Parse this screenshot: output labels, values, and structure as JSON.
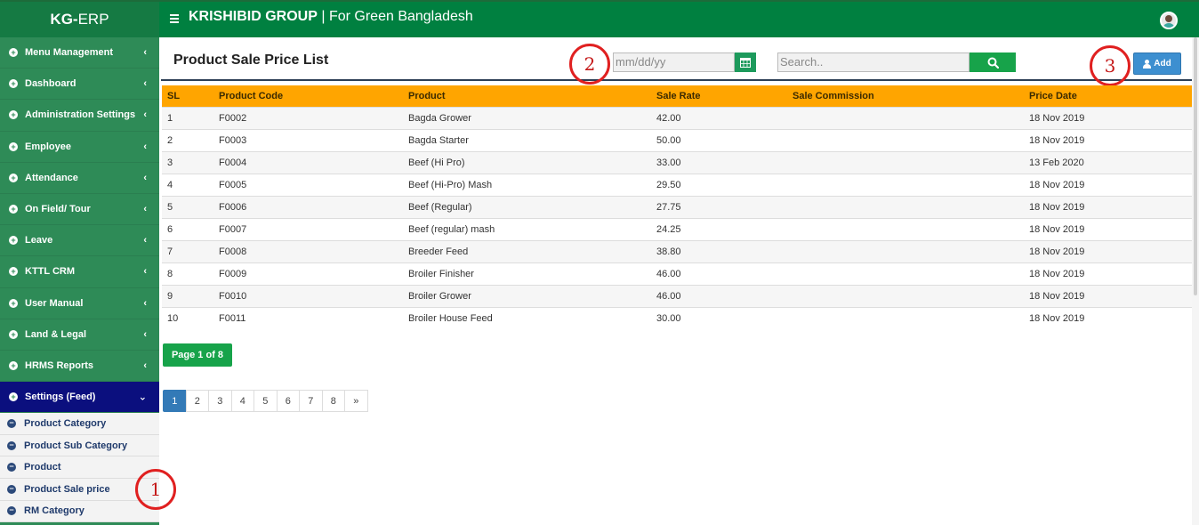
{
  "app": {
    "brand_bold": "KG-",
    "brand_rest": "ERP",
    "company_bold": "KRISHIBID GROUP",
    "company_rest": " | For Green Bangladesh"
  },
  "sidebar": {
    "items": [
      {
        "label": "Menu Management"
      },
      {
        "label": "Dashboard"
      },
      {
        "label": "Administration Settings"
      },
      {
        "label": "Employee"
      },
      {
        "label": "Attendance"
      },
      {
        "label": "On Field/ Tour"
      },
      {
        "label": "Leave"
      },
      {
        "label": "KTTL CRM"
      },
      {
        "label": "User Manual"
      },
      {
        "label": "Land & Legal"
      },
      {
        "label": "HRMS Reports"
      },
      {
        "label": "Settings (Feed)"
      }
    ],
    "sub_items": [
      {
        "label": "Product Category"
      },
      {
        "label": "Product Sub Category"
      },
      {
        "label": "Product"
      },
      {
        "label": "Product Sale price"
      },
      {
        "label": "RM Category"
      }
    ]
  },
  "main": {
    "title": "Product Sale Price List",
    "date_placeholder": "mm/dd/yy",
    "search_placeholder": "Search..",
    "add_label": "Add",
    "page_info": "Page 1 of 8"
  },
  "callouts": [
    "1",
    "2",
    "3"
  ],
  "table": {
    "headers": [
      "SL",
      "Product Code",
      "Product",
      "Sale Rate",
      "Sale Commission",
      "Price Date"
    ],
    "rows": [
      [
        "1",
        "F0002",
        "Bagda Grower",
        "42.00",
        "",
        "18 Nov 2019"
      ],
      [
        "2",
        "F0003",
        "Bagda Starter",
        "50.00",
        "",
        "18 Nov 2019"
      ],
      [
        "3",
        "F0004",
        "Beef (Hi Pro)",
        "33.00",
        "",
        "13 Feb 2020"
      ],
      [
        "4",
        "F0005",
        "Beef (Hi-Pro) Mash",
        "29.50",
        "",
        "18 Nov 2019"
      ],
      [
        "5",
        "F0006",
        "Beef (Regular)",
        "27.75",
        "",
        "18 Nov 2019"
      ],
      [
        "6",
        "F0007",
        "Beef (regular) mash",
        "24.25",
        "",
        "18 Nov 2019"
      ],
      [
        "7",
        "F0008",
        "Breeder Feed",
        "38.80",
        "",
        "18 Nov 2019"
      ],
      [
        "8",
        "F0009",
        "Broiler Finisher",
        "46.00",
        "",
        "18 Nov 2019"
      ],
      [
        "9",
        "F0010",
        "Broiler Grower",
        "46.00",
        "",
        "18 Nov 2019"
      ],
      [
        "10",
        "F0011",
        "Broiler House Feed",
        "30.00",
        "",
        "18 Nov 2019"
      ]
    ]
  },
  "pagination": [
    "1",
    "2",
    "3",
    "4",
    "5",
    "6",
    "7",
    "8",
    "»"
  ],
  "colors": {
    "topbar": "#008040",
    "sidebar": "#2e8b57",
    "active_menu": "#0b0f7e",
    "table_header": "#ffa500",
    "callout": "#e02020"
  }
}
